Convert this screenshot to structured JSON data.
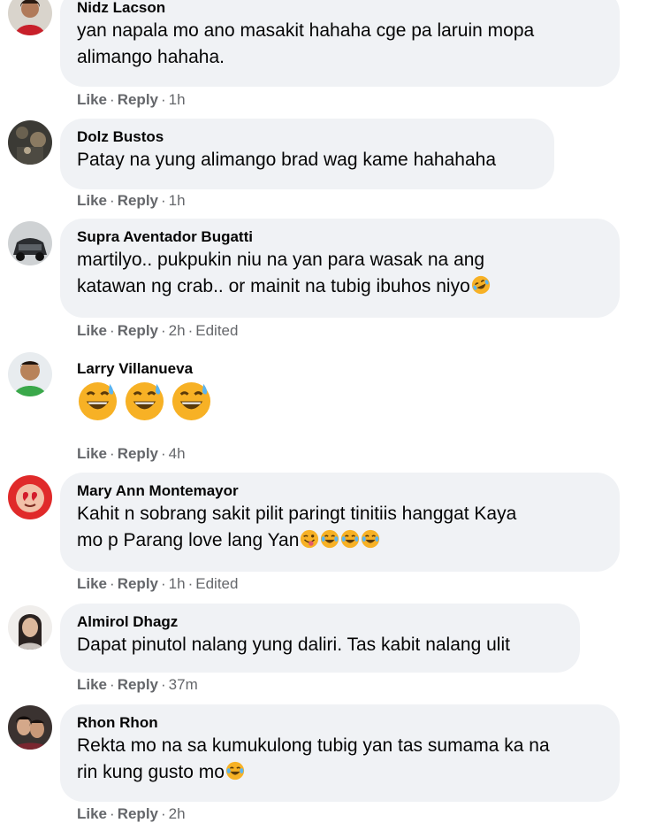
{
  "comments": [
    {
      "author": "Nidz Lacson",
      "lines": [
        "yan napala mo ano masakit hahaha cge pa laruin mopa",
        "alimango hahaha."
      ],
      "actions": {
        "like": "Like",
        "reply": "Reply",
        "time": "1h",
        "edited": ""
      }
    },
    {
      "author": "Dolz Bustos",
      "lines": [
        "Patay na yung alimango brad wag kame hahahaha"
      ],
      "actions": {
        "like": "Like",
        "reply": "Reply",
        "time": "1h",
        "edited": ""
      }
    },
    {
      "author": "Supra Aventador Bugatti",
      "lines": [
        "martilyo.. pukpukin niu na yan para wasak na ang",
        "katawan ng crab.. or mainit na tubig ibuhos niyo"
      ],
      "emojis": [
        "rolling-laughing"
      ],
      "actions": {
        "like": "Like",
        "reply": "Reply",
        "time": "2h",
        "edited": "Edited"
      }
    },
    {
      "author": "Larry Villanueva",
      "lines": [],
      "emojis": [
        "grinning-sweat",
        "grinning-sweat",
        "grinning-sweat"
      ],
      "actions": {
        "like": "Like",
        "reply": "Reply",
        "time": "4h",
        "edited": ""
      }
    },
    {
      "author": "Mary Ann Montemayor",
      "lines": [
        "Kahit n sobrang sakit pilit paringt tinitiis hanggat Kaya",
        "mo p Parang love lang Yan"
      ],
      "emojis": [
        "winking-tongue",
        "tears-of-joy",
        "tears-of-joy",
        "tears-of-joy"
      ],
      "actions": {
        "like": "Like",
        "reply": "Reply",
        "time": "1h",
        "edited": "Edited"
      }
    },
    {
      "author": "Almirol Dhagz",
      "lines": [
        "Dapat pinutol nalang yung daliri. Tas kabit nalang ulit"
      ],
      "actions": {
        "like": "Like",
        "reply": "Reply",
        "time": "37m",
        "edited": ""
      }
    },
    {
      "author": "Rhon Rhon",
      "lines": [
        "Rekta mo na sa kumukulong tubig yan tas sumama ka na",
        "rin kung gusto mo"
      ],
      "emojis": [
        "tears-of-joy"
      ],
      "actions": {
        "like": "Like",
        "reply": "Reply",
        "time": "2h",
        "edited": ""
      }
    }
  ]
}
